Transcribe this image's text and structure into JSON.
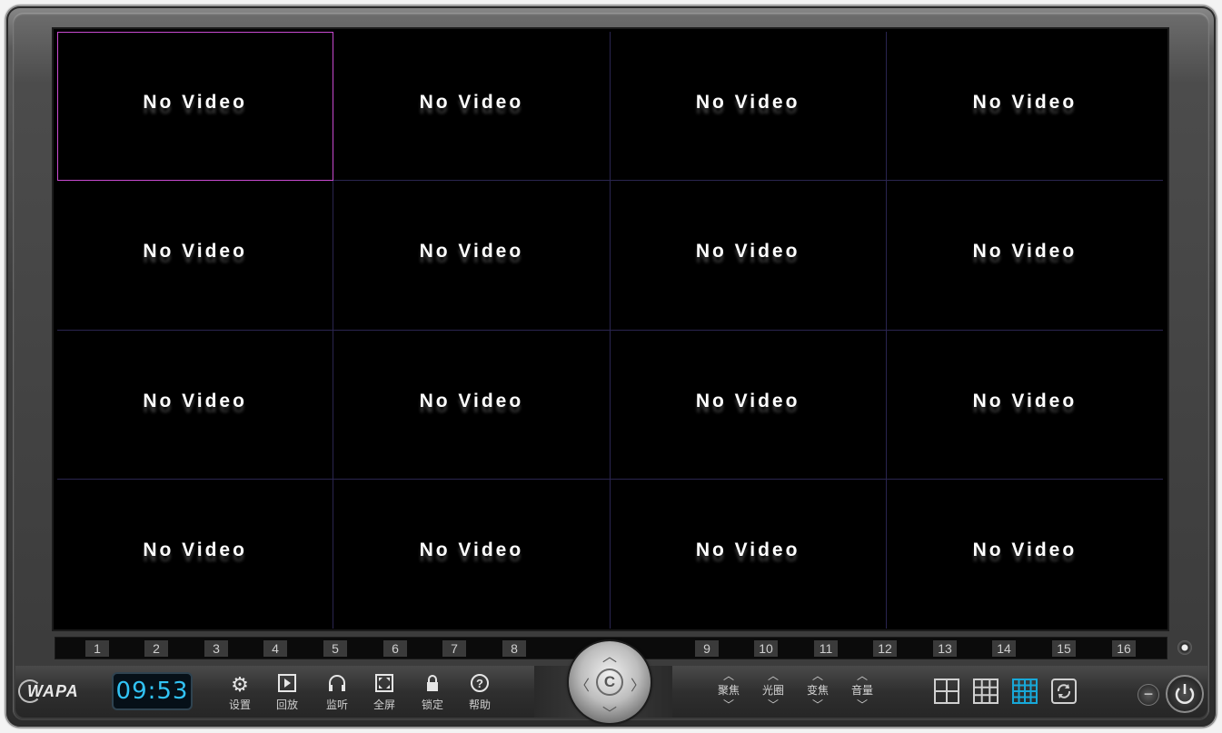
{
  "wall": {
    "cells": [
      {
        "text": "No Video"
      },
      {
        "text": "No Video"
      },
      {
        "text": "No Video"
      },
      {
        "text": "No Video"
      },
      {
        "text": "No Video"
      },
      {
        "text": "No Video"
      },
      {
        "text": "No Video"
      },
      {
        "text": "No Video"
      },
      {
        "text": "No Video"
      },
      {
        "text": "No Video"
      },
      {
        "text": "No Video"
      },
      {
        "text": "No Video"
      },
      {
        "text": "No Video"
      },
      {
        "text": "No Video"
      },
      {
        "text": "No Video"
      },
      {
        "text": "No Video"
      }
    ],
    "selected_cell": 1,
    "selection_color": "#c84ad0"
  },
  "channels": [
    "1",
    "2",
    "3",
    "4",
    "5",
    "6",
    "7",
    "8",
    "9",
    "10",
    "11",
    "12",
    "13",
    "14",
    "15",
    "16"
  ],
  "logo": "WAPA",
  "clock": "09:53",
  "toolbar": {
    "settings": "设置",
    "playback": "回放",
    "listen": "监听",
    "fullscreen": "全屏",
    "lock": "锁定",
    "help": "帮助"
  },
  "ptz": {
    "center": "C"
  },
  "adjust": {
    "focus": "聚焦",
    "iris": "光圈",
    "zoom": "变焦",
    "volume": "音量"
  },
  "layouts": [
    "layout-4-icon",
    "layout-9-icon",
    "layout-16-icon",
    "cycle-icon"
  ],
  "active_layout": "layout-16-icon",
  "accent_color": "#31c3f5"
}
